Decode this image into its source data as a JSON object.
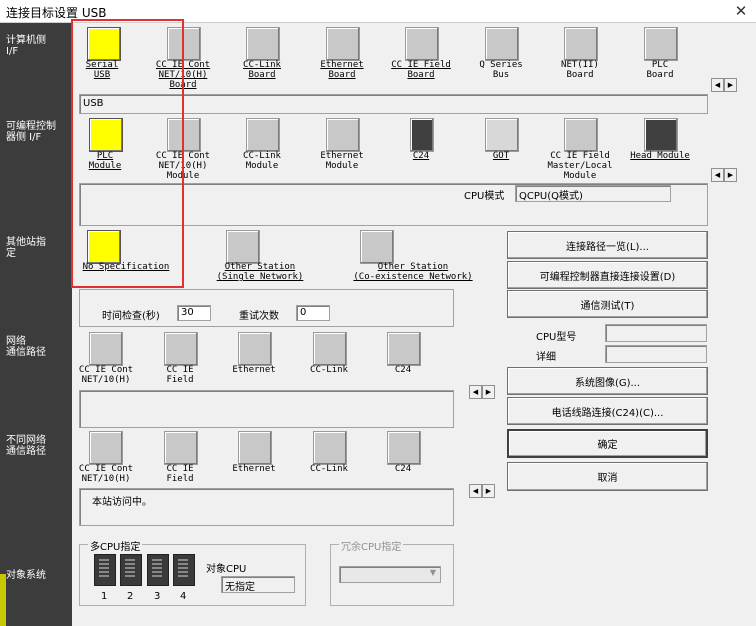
{
  "window": {
    "title": "连接目标设置 USB",
    "close": "✕"
  },
  "sidebar": {
    "pc_if": "计算机侧\nI/F",
    "plc_if": "可编程控制\n器侧 I/F",
    "other_station": "其他站指\n定",
    "network_route": "网络\n通信路径",
    "diff_network_route": "不同网络\n通信路径",
    "target_system": "对象系统"
  },
  "pc_side": {
    "items": [
      {
        "label": "Serial\nUSB",
        "icon": "serial-usb-icon"
      },
      {
        "label": "CC IE Cont\nNET/10(H)\nBoard",
        "icon": "cc-ie-board-icon"
      },
      {
        "label": "CC-Link\nBoard",
        "icon": "cc-link-board-icon"
      },
      {
        "label": "Ethernet\nBoard",
        "icon": "ethernet-board-icon"
      },
      {
        "label": "CC IE Field\nBoard",
        "icon": "cc-ie-field-board-icon"
      },
      {
        "label": "Q Series\nBus",
        "icon": "q-series-bus-icon"
      },
      {
        "label": "NET(II)\nBoard",
        "icon": "net-ii-board-icon"
      },
      {
        "label": "PLC\nBoard",
        "icon": "plc-board-icon"
      }
    ],
    "info": "USB"
  },
  "plc_side": {
    "items": [
      {
        "label": "PLC\nModule",
        "icon": "plc-module-icon"
      },
      {
        "label": "CC IE Cont\nNET/10(H)\nModule",
        "icon": "cc-ie-module-icon"
      },
      {
        "label": "CC-Link\nModule",
        "icon": "cc-link-module-icon"
      },
      {
        "label": "Ethernet\nModule",
        "icon": "ethernet-module-icon"
      },
      {
        "label": "C24",
        "icon": "c24-icon"
      },
      {
        "label": "GOT",
        "icon": "got-icon"
      },
      {
        "label": "CC IE Field\nMaster/Local\nModule",
        "icon": "cc-ie-field-master-icon"
      },
      {
        "label": "Head Module",
        "icon": "head-module-icon"
      }
    ],
    "cpu_mode_label": "CPU模式",
    "cpu_mode_value": "QCPU(Q模式)"
  },
  "other_station": {
    "items": [
      {
        "label": "No Specification"
      },
      {
        "label": "Other Station\n(Single Network)"
      },
      {
        "label": "Other Station\n(Co-existence Network)"
      }
    ],
    "time_check_label": "时间检查(秒)",
    "time_check_value": "30",
    "retry_label": "重试次数",
    "retry_value": "0"
  },
  "network_route": {
    "items": [
      {
        "label": "CC IE Cont\nNET/10(H)"
      },
      {
        "label": "CC IE\nField"
      },
      {
        "label": "Ethernet"
      },
      {
        "label": "CC-Link"
      },
      {
        "label": "C24"
      }
    ]
  },
  "diff_network_route": {
    "items": [
      {
        "label": "CC IE Cont\nNET/10(H)"
      },
      {
        "label": "CC IE\nField"
      },
      {
        "label": "Ethernet"
      },
      {
        "label": "CC-Link"
      },
      {
        "label": "C24"
      }
    ],
    "status": "本站访问中。"
  },
  "buttons": {
    "route_list": "连接路径一览(L)...",
    "direct_connect": "可编程控制器直接连接设置(D)",
    "comm_test": "通信测试(T)",
    "system_image": "系统图像(G)...",
    "phone_connect": "电话线路连接(C24)(C)...",
    "ok": "确定",
    "cancel": "取消"
  },
  "cpu_info": {
    "cpu_type_label": "CPU型号",
    "detail_label": "详细"
  },
  "target_system": {
    "multi_cpu_title": "多CPU指定",
    "cpu_numbers": [
      "1",
      "2",
      "3",
      "4"
    ],
    "target_cpu_label": "对象CPU",
    "target_cpu_value": "无指定",
    "redundant_title": "冗余CPU指定"
  }
}
